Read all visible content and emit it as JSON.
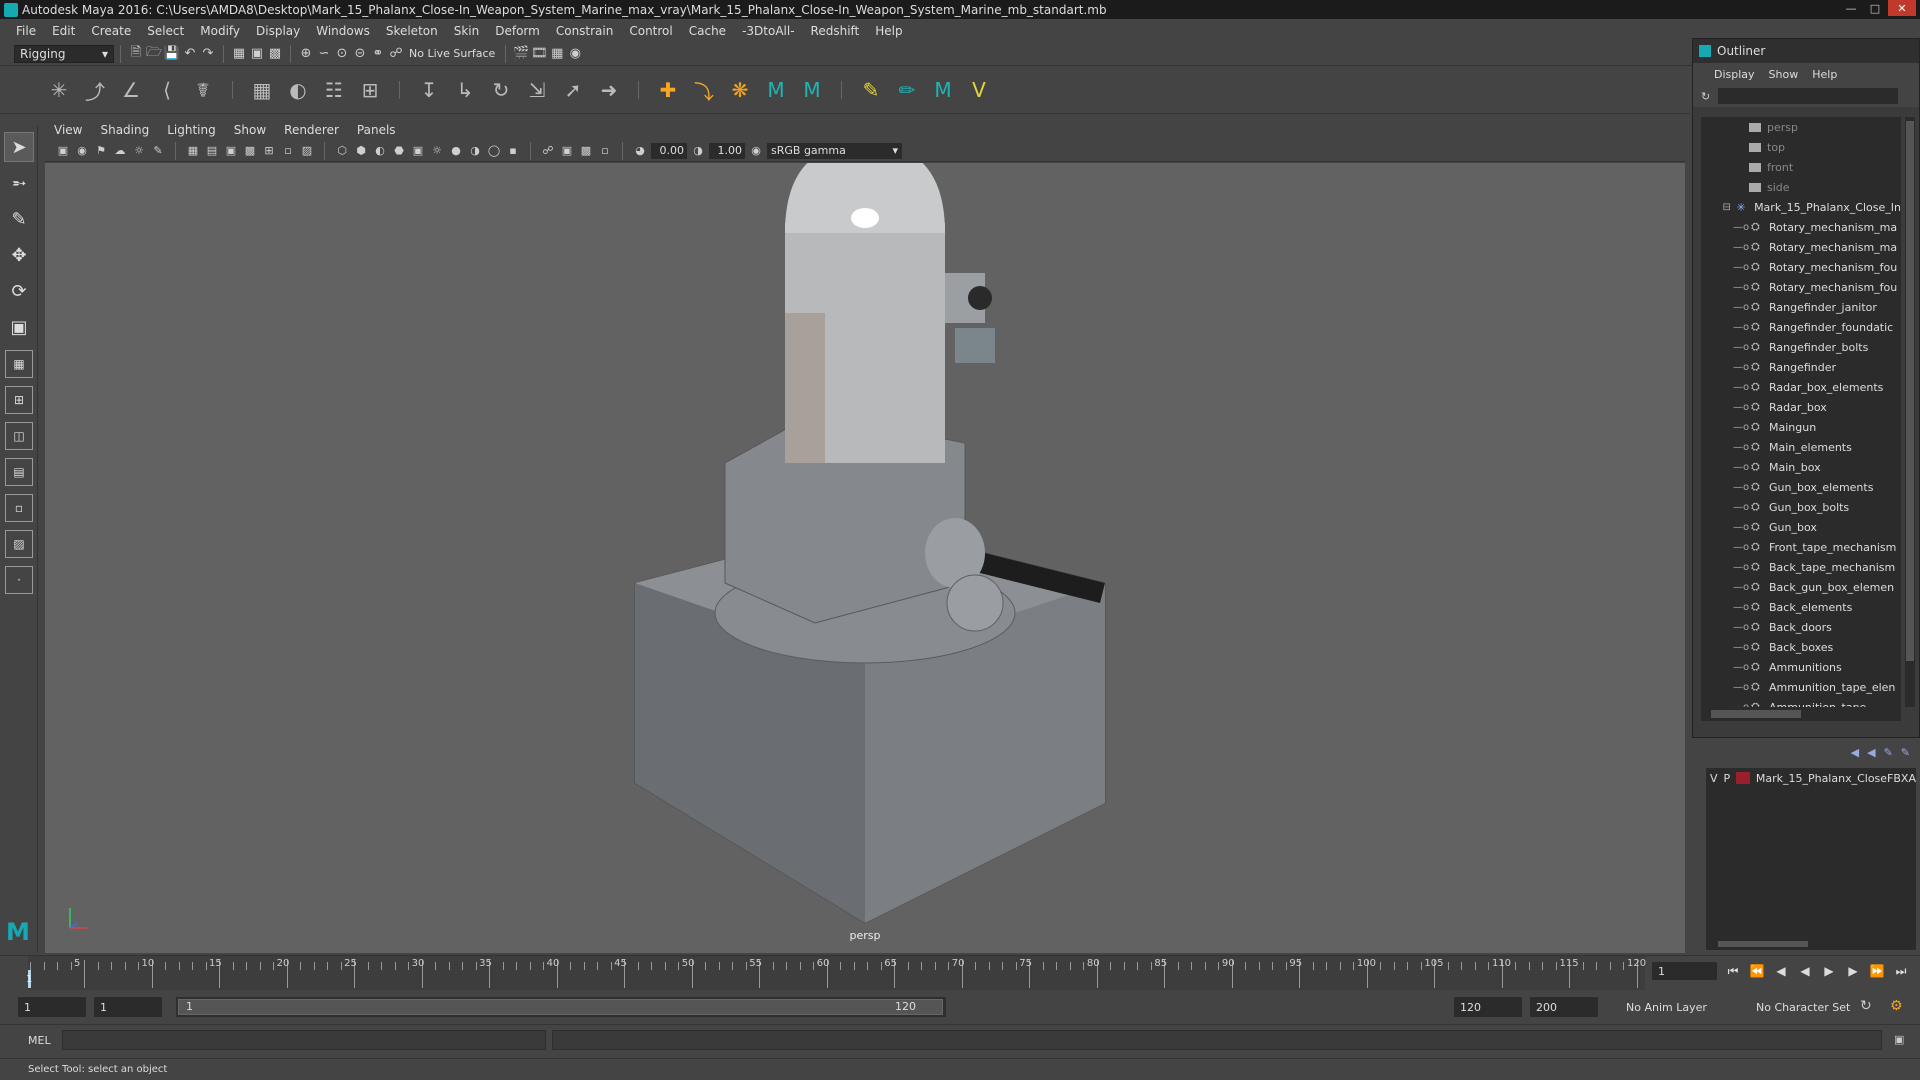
{
  "window": {
    "title": "Autodesk Maya 2016: C:\\Users\\AMDA8\\Desktop\\Mark_15_Phalanx_Close-In_Weapon_System_Marine_max_vray\\Mark_15_Phalanx_Close-In_Weapon_System_Marine_mb_standart.mb"
  },
  "menubar": [
    "File",
    "Edit",
    "Create",
    "Select",
    "Modify",
    "Display",
    "Windows",
    "Skeleton",
    "Skin",
    "Deform",
    "Constrain",
    "Control",
    "Cache",
    "-3DtoAll-",
    "Redshift",
    "Help"
  ],
  "statusline": {
    "mode": "Rigging",
    "live_surface": "No Live Surface"
  },
  "viewport": {
    "menu": [
      "View",
      "Shading",
      "Lighting",
      "Show",
      "Renderer",
      "Panels"
    ],
    "exposure": "0.00",
    "gamma": "1.00",
    "color_space": "sRGB gamma",
    "camera_label": "persp"
  },
  "outliner": {
    "title": "Outliner",
    "menu": [
      "Display",
      "Show",
      "Help"
    ],
    "cameras": [
      "persp",
      "top",
      "front",
      "side"
    ],
    "root": "Mark_15_Phalanx_Close_In",
    "children": [
      "Rotary_mechanism_ma",
      "Rotary_mechanism_ma",
      "Rotary_mechanism_fou",
      "Rotary_mechanism_fou",
      "Rangefinder_janitor",
      "Rangefinder_foundatic",
      "Rangefinder_bolts",
      "Rangefinder",
      "Radar_box_elements",
      "Radar_box",
      "Maingun",
      "Main_elements",
      "Main_box",
      "Gun_box_elements",
      "Gun_box_bolts",
      "Gun_box",
      "Front_tape_mechanism",
      "Back_tape_mechanism",
      "Back_gun_box_elemen",
      "Back_elements",
      "Back_doors",
      "Back_boxes",
      "Ammunitions",
      "Ammunition_tape_elen",
      "Ammunition_tape"
    ]
  },
  "layer": {
    "v": "V",
    "p": "P",
    "name": "Mark_15_Phalanx_CloseFBXA",
    "color": "#9a1e2b"
  },
  "timeline": {
    "ticks": [
      "5",
      "10",
      "15",
      "20",
      "25",
      "30",
      "35",
      "40",
      "45",
      "50",
      "55",
      "60",
      "65",
      "70",
      "75",
      "80",
      "85",
      "90",
      "95",
      "100",
      "105",
      "110",
      "115",
      "120"
    ],
    "current_frame": "1",
    "current_frame_field": "1"
  },
  "range": {
    "start": "1",
    "anim_start": "1",
    "slider_start": "1",
    "slider_end": "120",
    "end": "120",
    "anim_end": "200",
    "anim_layer": "No Anim Layer",
    "character_set": "No Character Set"
  },
  "cmdline": {
    "label": "MEL"
  },
  "helpline": {
    "text": "Select Tool: select an object"
  }
}
